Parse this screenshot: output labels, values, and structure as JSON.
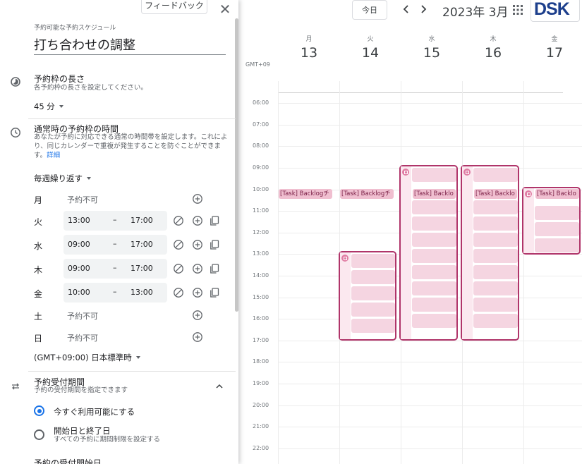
{
  "panel": {
    "feedback_label": "フィードバック",
    "section_caption": "予約可能な予約スケジュール",
    "title_value": "打ち合わせの調整",
    "slot_length": {
      "title": "予約枠の長さ",
      "subtitle": "各予約枠の長さを設定してください。",
      "value": "45 分"
    },
    "availability": {
      "title": "通常時の予約枠の時間",
      "subtitle_line1": "あなたが予約に対応できる通常の時間帯を設定します。これによ",
      "subtitle_line2": "り、同じカレンダーで重複が発生することを防ぐことができま",
      "subtitle_line3": "す。",
      "link": "詳細",
      "repeat": "毎週繰り返す",
      "unavailable_label": "予約不可",
      "dash": "–",
      "days": [
        {
          "day": "月",
          "available": false
        },
        {
          "day": "火",
          "available": true,
          "start": "13:00",
          "end": "17:00"
        },
        {
          "day": "水",
          "available": true,
          "start": "09:00",
          "end": "17:00"
        },
        {
          "day": "木",
          "available": true,
          "start": "09:00",
          "end": "17:00"
        },
        {
          "day": "金",
          "available": true,
          "start": "10:00",
          "end": "13:00"
        },
        {
          "day": "土",
          "available": false
        },
        {
          "day": "日",
          "available": false
        }
      ],
      "timezone": "(GMT+09:00) 日本標準時"
    },
    "booking_window": {
      "title": "予約受付期間",
      "subtitle": "予約の受付期間を指定できます",
      "option1": "今すぐ利用可能にする",
      "option2": "開始日と終了日",
      "option2_sub": "すべての予約に期間制限を設定する",
      "cut_off_label": "予約の受付開始日"
    }
  },
  "topbar": {
    "today_label": "今日",
    "month_title": "2023年 3月",
    "logo_text": "DSK"
  },
  "calendar": {
    "tz_label": "GMT+09",
    "columns": [
      {
        "dow": "月",
        "date": "13"
      },
      {
        "dow": "火",
        "date": "14"
      },
      {
        "dow": "水",
        "date": "15"
      },
      {
        "dow": "木",
        "date": "16"
      },
      {
        "dow": "金",
        "date": "17"
      }
    ],
    "hours": [
      "06:00",
      "07:00",
      "08:00",
      "09:00",
      "10:00",
      "11:00",
      "12:00",
      "13:00",
      "14:00",
      "15:00",
      "16:00",
      "17:00",
      "18:00",
      "19:00",
      "20:00",
      "21:00",
      "22:00"
    ],
    "task_label": "[Task] Backlogチ",
    "task_label_short": "[Task] Backlo"
  },
  "colors": {
    "accent": "#1a73e8",
    "slot_border": "#b0356a",
    "slot_fill": "#f5d5e1",
    "task_chip": "#f0bfd0"
  }
}
